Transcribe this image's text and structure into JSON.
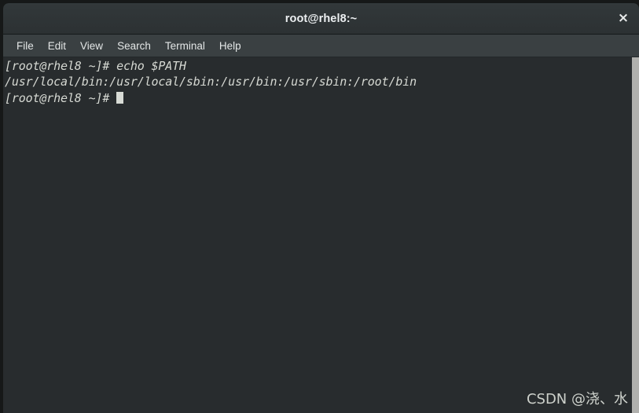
{
  "window": {
    "title": "root@rhel8:~",
    "close_label": "×",
    "bg_color": "#282c2e",
    "titlebar_color": "#2e3436",
    "menubar_color": "#393f3f",
    "text_color": "#d6d9d3",
    "scrollbar_color": "#b0b0ad"
  },
  "menubar": {
    "items": [
      {
        "label": "File"
      },
      {
        "label": "Edit"
      },
      {
        "label": "View"
      },
      {
        "label": "Search"
      },
      {
        "label": "Terminal"
      },
      {
        "label": "Help"
      }
    ]
  },
  "terminal": {
    "lines": [
      {
        "text": "[root@rhel8 ~]# echo $PATH",
        "cursor": false
      },
      {
        "text": "/usr/local/bin:/usr/local/sbin:/usr/bin:/usr/sbin:/root/bin",
        "cursor": false
      },
      {
        "text": "[root@rhel8 ~]# ",
        "cursor": true
      }
    ],
    "prompt": "[root@rhel8 ~]#",
    "command": "echo $PATH",
    "output": "/usr/local/bin:/usr/local/sbin:/usr/bin:/usr/sbin:/root/bin"
  },
  "watermark": {
    "text": "CSDN @浇、水"
  }
}
